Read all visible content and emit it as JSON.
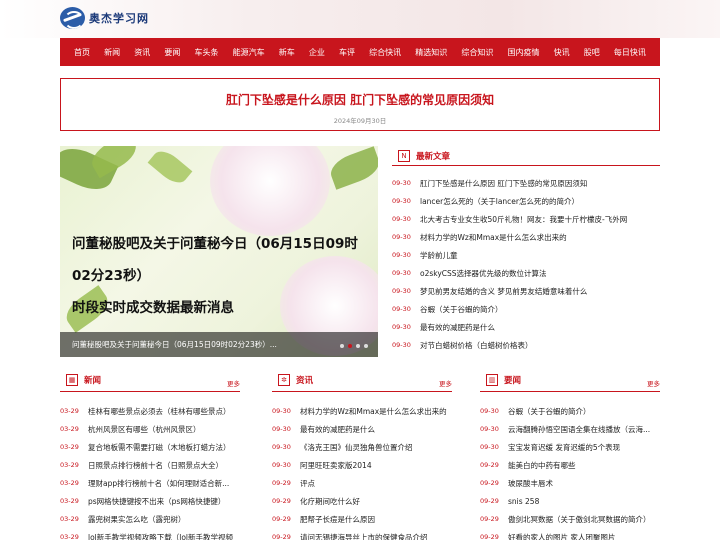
{
  "site": {
    "name": "奥杰学习网"
  },
  "nav": [
    "首页",
    "新闻",
    "资讯",
    "要闻",
    "车头条",
    "能源汽车",
    "新车",
    "企业",
    "车评",
    "综合快讯",
    "精选知识",
    "综合知识",
    "国内疫情",
    "快讯",
    "股吧",
    "每日快讯"
  ],
  "article": {
    "title": "肛门下坠感是什么原因 肛门下坠感的常见原因须知",
    "date": "2024年09月30日"
  },
  "slider": {
    "line1": "问董秘股吧及关于问董秘今日（06月15日09时02分23秒）",
    "line2": "时段实时成交数据最新消息",
    "caption": "问董秘股吧及关于问董秘今日（06月15日09时02分23秒）..."
  },
  "latest": {
    "title": "最新文章",
    "icon": "N",
    "items": [
      {
        "d": "09-30",
        "t": "肛门下坠感是什么原因 肛门下坠感的常见原因须知"
      },
      {
        "d": "09-30",
        "t": "lancer怎么死的（关于lancer怎么死的的简介）"
      },
      {
        "d": "09-30",
        "t": "北大考古专业女生收50斤礼物！网友：我要十斤柠檬皮-飞外网"
      },
      {
        "d": "09-30",
        "t": "材料力学的Wz和Mmax是什么怎么求出来的"
      },
      {
        "d": "09-30",
        "t": "学龄前儿童"
      },
      {
        "d": "09-30",
        "t": "o2skyCSS选择器优先级的数位计算法"
      },
      {
        "d": "09-30",
        "t": "梦见前男友结婚的含义 梦见前男友结婚意味着什么"
      },
      {
        "d": "09-30",
        "t": "谷蝦（关于谷蝦的简介）"
      },
      {
        "d": "09-30",
        "t": "最有效的减肥药是什么"
      },
      {
        "d": "09-30",
        "t": "对节白蜡树价格（白蜡树价格表）"
      }
    ]
  },
  "news": {
    "title": "新闻",
    "more": "更多",
    "items": [
      {
        "d": "03-29",
        "t": "桂林有哪些景点必须去（桂林有哪些景点）"
      },
      {
        "d": "03-29",
        "t": "杭州风景区有哪些（杭州风景区）"
      },
      {
        "d": "03-29",
        "t": "复合地板需不需要打磁（木地板打蜡方法）"
      },
      {
        "d": "03-29",
        "t": "日照景点排行榜前十名（日照景点大全）"
      },
      {
        "d": "03-29",
        "t": "理财app排行榜前十名（如何理财适合新..."
      },
      {
        "d": "03-29",
        "t": "ps网格快捷键按不出来（ps网格快捷键）"
      },
      {
        "d": "03-29",
        "t": "露兜树果实怎么吃（露兜树）"
      },
      {
        "d": "03-29",
        "t": "lol新手教学视频攻略下载（lol新手教学视频"
      }
    ]
  },
  "info": {
    "title": "资讯",
    "more": "更多",
    "items": [
      {
        "d": "09-30",
        "t": "材料力学的Wz和Mmax是什么怎么求出来的"
      },
      {
        "d": "09-30",
        "t": "最有效的减肥药是什么"
      },
      {
        "d": "09-30",
        "t": "《洛克王国》仙灵独角兽位置介绍"
      },
      {
        "d": "09-30",
        "t": "阿里旺旺卖家版2014"
      },
      {
        "d": "09-29",
        "t": "评点"
      },
      {
        "d": "09-29",
        "t": "化疗期间吃什么好"
      },
      {
        "d": "09-29",
        "t": "肥帮子长痘是什么原因"
      },
      {
        "d": "09-29",
        "t": "请问无锡捷海导丝上市的保健食品介绍"
      }
    ]
  },
  "headlines": {
    "title": "要闻",
    "more": "更多",
    "items": [
      {
        "d": "09-30",
        "t": "谷蝦（关于谷蝦的简介）"
      },
      {
        "d": "09-30",
        "t": "云海翻腾孙悟空国语全集在线播放（云海..."
      },
      {
        "d": "09-30",
        "t": "宝宝发育迟缓 发育迟缓的5个表现"
      },
      {
        "d": "09-29",
        "t": "能美白的中药有哪些"
      },
      {
        "d": "09-29",
        "t": "玻尿酸丰唇术"
      },
      {
        "d": "09-29",
        "t": "snis 258"
      },
      {
        "d": "09-29",
        "t": "傲剑北冥数据（关于傲剑北冥数据的简介）"
      },
      {
        "d": "09-29",
        "t": "好看的家人的图片 家人团聚图片"
      }
    ]
  }
}
